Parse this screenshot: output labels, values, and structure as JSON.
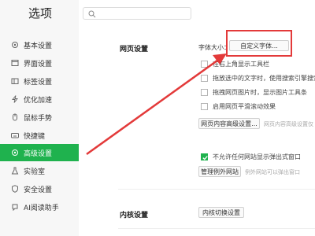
{
  "app": {
    "title": "选项"
  },
  "search": {
    "placeholder": ""
  },
  "sidebar": {
    "items": [
      {
        "label": "基本设置"
      },
      {
        "label": "界面设置"
      },
      {
        "label": "标签设置"
      },
      {
        "label": "优化加速"
      },
      {
        "label": "鼠标手势"
      },
      {
        "label": "快捷键"
      },
      {
        "label": "高级设置"
      },
      {
        "label": "实验室"
      },
      {
        "label": "安全设置"
      },
      {
        "label": "AI阅读助手"
      }
    ]
  },
  "main": {
    "web_section": {
      "title": "网页设置",
      "font_size_label": "字体大小：",
      "custom_font_button": "自定义字体...",
      "options": [
        {
          "label": "在右上角显示工具栏",
          "checked": false
        },
        {
          "label": "拖放选中的文字时，使用搜索引擎搜索",
          "checked": false
        },
        {
          "label": "拖拽网页图片时，显示图片工具条",
          "checked": false
        },
        {
          "label": "启用网页平滑滚动效果",
          "checked": false
        }
      ],
      "advanced_button": "网页内容高级设置...",
      "advanced_note": "网页内容高级设置仅",
      "popup_option": {
        "label": "不允许任何网站显示弹出式窗口",
        "checked": true
      },
      "manage_exceptions_button": "管理例外网站",
      "exceptions_note": "例外网站可以弹出窗口"
    },
    "kernel_section": {
      "title": "内核设置",
      "switch_button": "内核切换设置"
    }
  },
  "colors": {
    "accent": "#1fb24e",
    "highlight": "#e33a3a"
  }
}
